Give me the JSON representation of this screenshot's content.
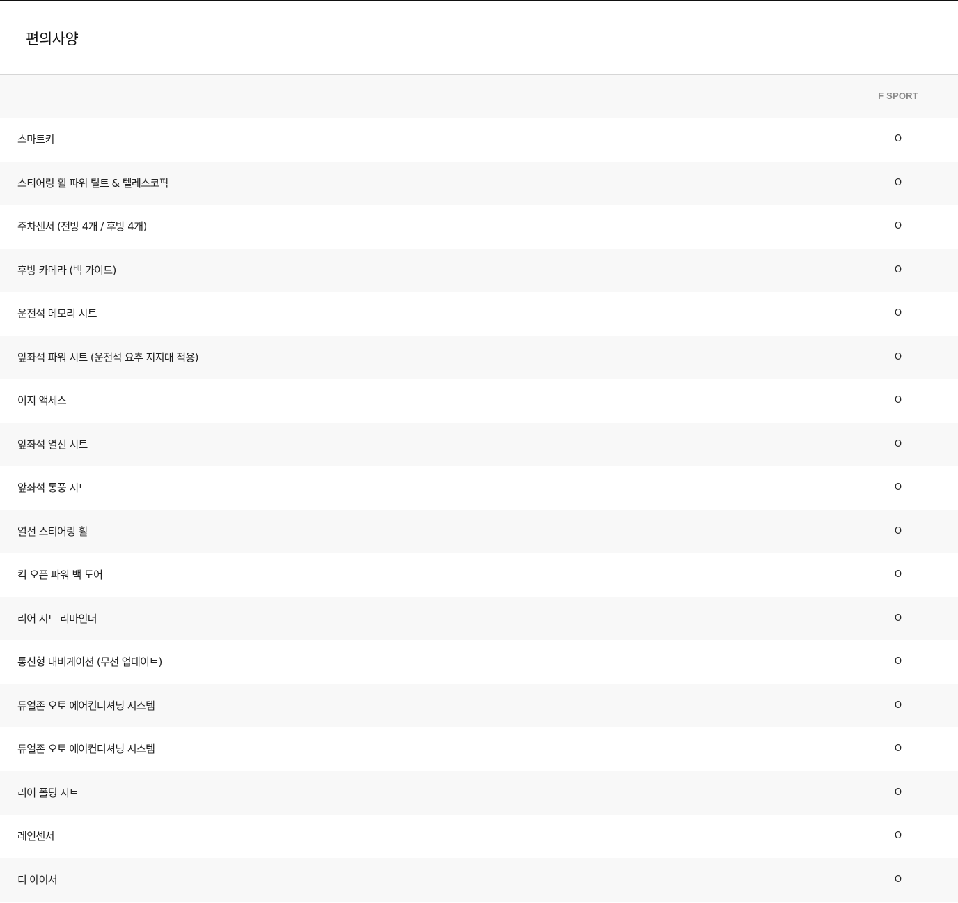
{
  "section": {
    "title": "편의사양",
    "collapse_icon": "minus-icon"
  },
  "table": {
    "column_header": "F SPORT",
    "rows": [
      {
        "label": "스마트키",
        "value": "O"
      },
      {
        "label": "스티어링 휠 파워 틸트 & 텔레스코픽",
        "value": "O"
      },
      {
        "label": "주차센서 (전방 4개 / 후방 4개)",
        "value": "O"
      },
      {
        "label": "후방 카메라 (백 가이드)",
        "value": "O"
      },
      {
        "label": "운전석 메모리 시트",
        "value": "O"
      },
      {
        "label": "앞좌석 파워 시트 (운전석 요추 지지대 적용)",
        "value": "O"
      },
      {
        "label": "이지 액세스",
        "value": "O"
      },
      {
        "label": "앞좌석 열선 시트",
        "value": "O"
      },
      {
        "label": "앞좌석 통풍 시트",
        "value": "O"
      },
      {
        "label": "열선 스티어링 휠",
        "value": "O"
      },
      {
        "label": "킥 오픈 파워 백 도어",
        "value": "O"
      },
      {
        "label": "리어 시트 리마인더",
        "value": "O"
      },
      {
        "label": "통신형 내비게이션 (무선 업데이트)",
        "value": "O"
      },
      {
        "label": "듀얼존 오토 에어컨디셔닝 시스템",
        "value": "O"
      },
      {
        "label": "듀얼존 오토 에어컨디셔닝 시스템",
        "value": "O"
      },
      {
        "label": "리어 폴딩 시트",
        "value": "O"
      },
      {
        "label": "레인센서",
        "value": "O"
      },
      {
        "label": "디 아이서",
        "value": "O"
      }
    ]
  }
}
